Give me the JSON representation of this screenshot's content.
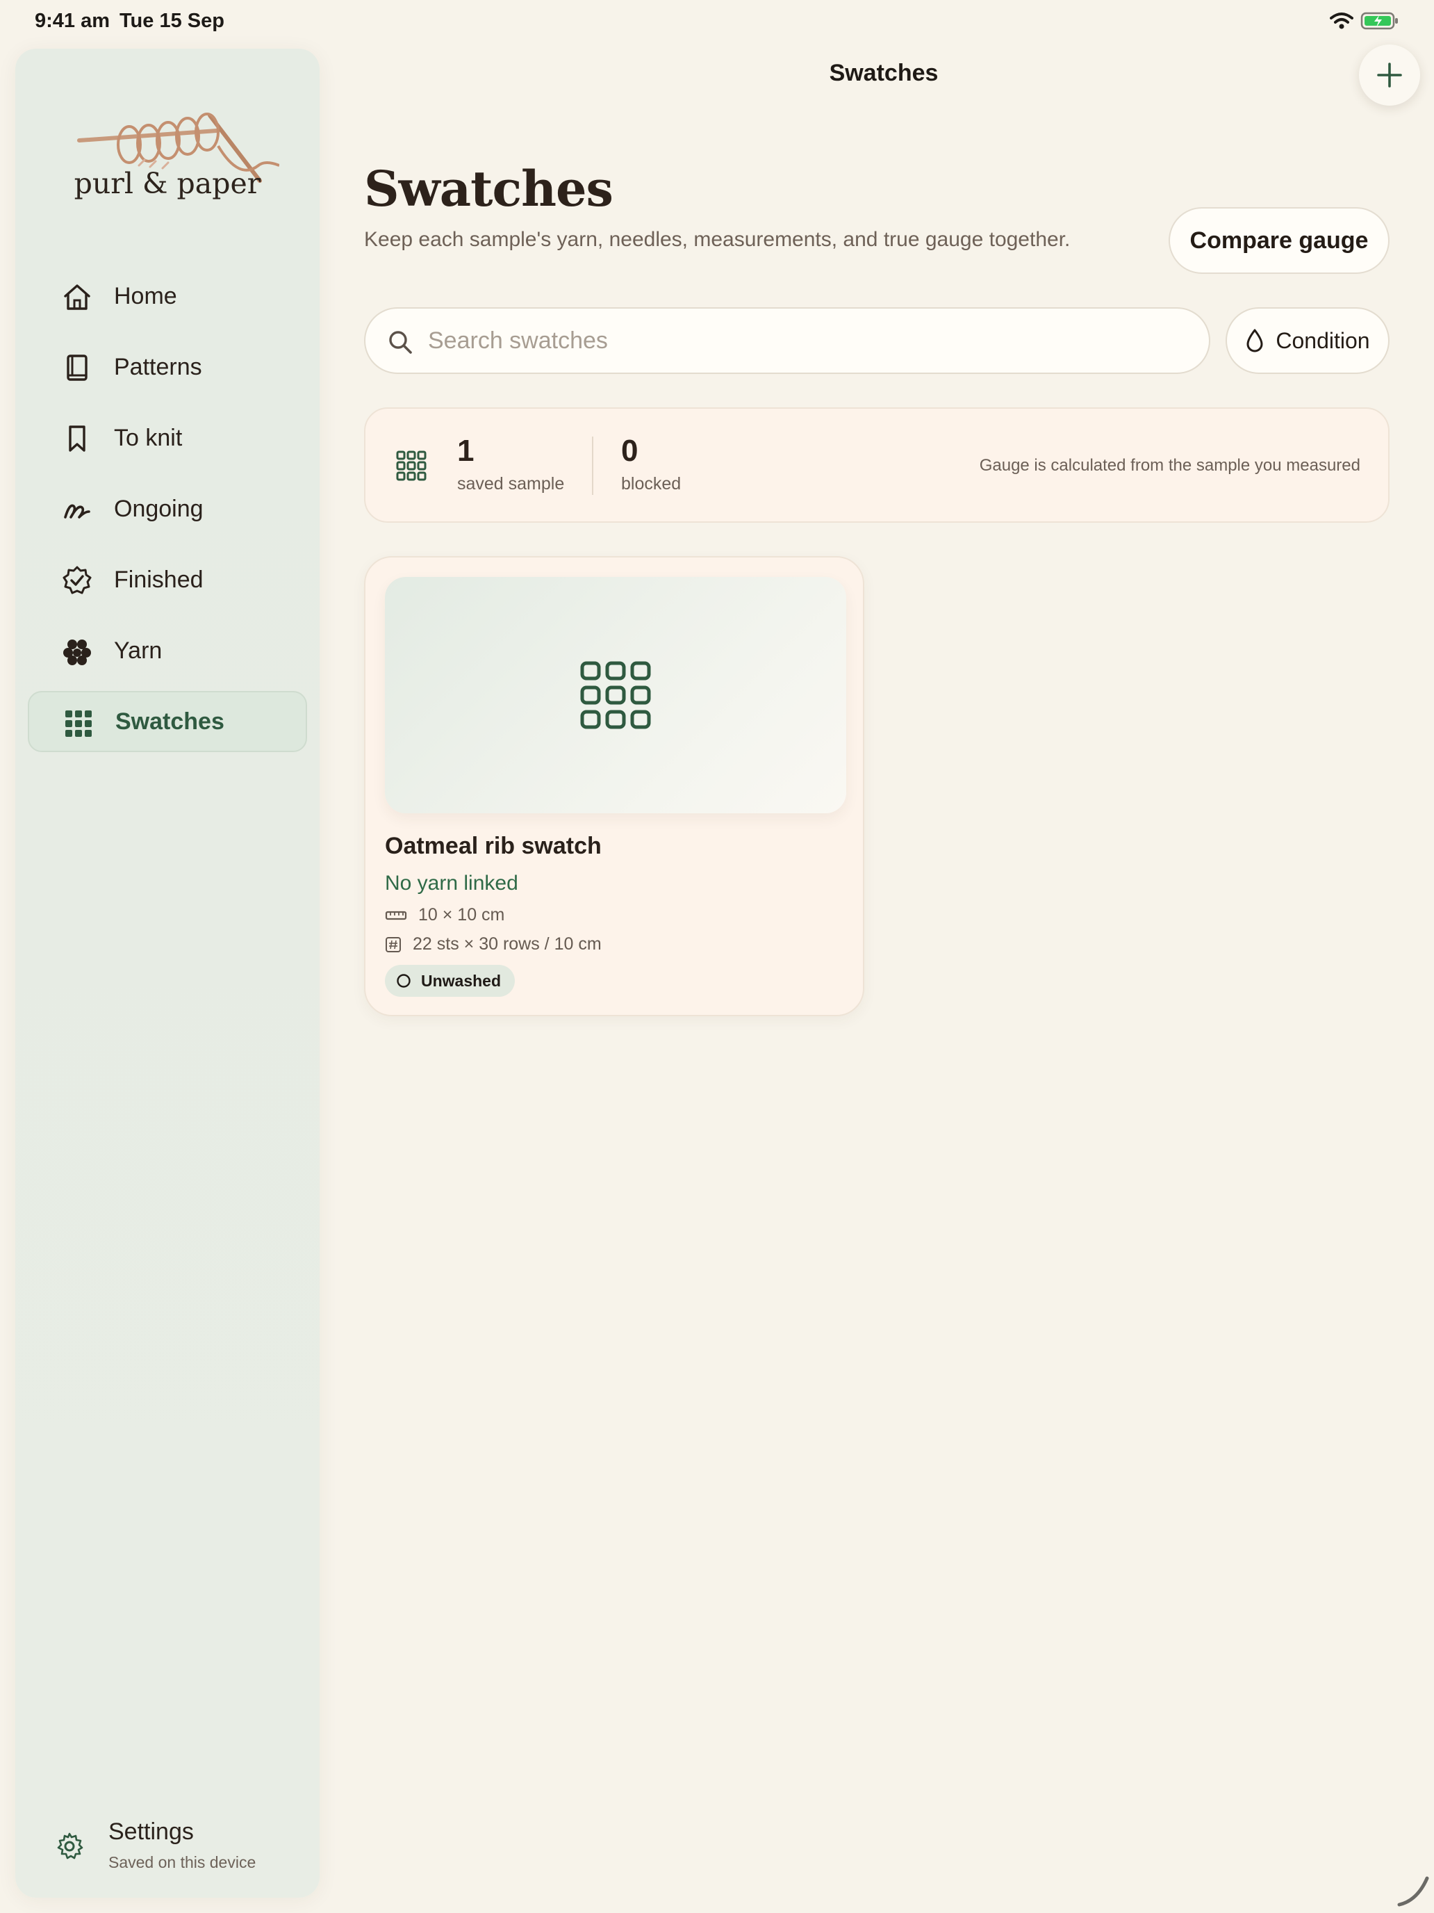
{
  "status_bar": {
    "time": "9:41 am",
    "date": "Tue 15 Sep"
  },
  "sidebar": {
    "brand": "purl & paper",
    "items": [
      {
        "label": "Home",
        "icon": "home-icon"
      },
      {
        "label": "Patterns",
        "icon": "book-icon"
      },
      {
        "label": "To knit",
        "icon": "bookmark-icon"
      },
      {
        "label": "Ongoing",
        "icon": "scribble-icon"
      },
      {
        "label": "Finished",
        "icon": "check-badge-icon"
      },
      {
        "label": "Yarn",
        "icon": "yarn-balls-icon"
      },
      {
        "label": "Swatches",
        "icon": "grid-icon",
        "active": true
      }
    ],
    "settings": {
      "title": "Settings",
      "subtitle": "Saved on this device"
    }
  },
  "topbar": {
    "title": "Swatches"
  },
  "header": {
    "title": "Swatches",
    "subtitle": "Keep each sample's yarn, needles, measurements, and true gauge together.",
    "compare_label": "Compare gauge"
  },
  "search": {
    "placeholder": "Search swatches",
    "value": ""
  },
  "filter": {
    "condition_label": "Condition"
  },
  "stats": {
    "saved_count": "1",
    "saved_label": "saved sample",
    "blocked_count": "0",
    "blocked_label": "blocked",
    "note": "Gauge is calculated from the sample you measured"
  },
  "swatches": [
    {
      "title": "Oatmeal rib swatch",
      "yarn": "No yarn linked",
      "size": "10 × 10 cm",
      "gauge": "22 sts × 30 rows / 10 cm",
      "condition": "Unwashed"
    }
  ],
  "colors": {
    "accent": "#2f5a40",
    "background": "#f7f3ea",
    "sidebar": "#e6ece4",
    "card": "#fdf3ea"
  }
}
